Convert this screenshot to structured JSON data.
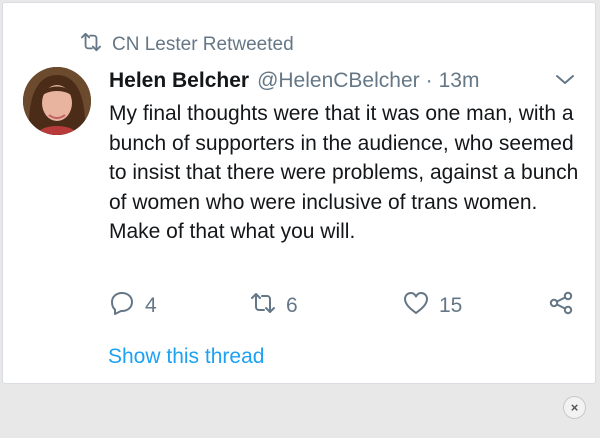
{
  "retweet": {
    "icon": "retweet-icon",
    "text": "CN Lester Retweeted"
  },
  "tweet": {
    "author_name": "Helen Belcher",
    "author_handle": "@HelenCBelcher",
    "separator": "·",
    "time": "13m",
    "text": "My final thoughts were that it was one man, with a bunch of supporters in the audience, who seemed to insist that there were problems, against a bunch of women who were inclusive of trans women. Make of that what you will.",
    "actions": {
      "reply_count": "4",
      "retweet_count": "6",
      "like_count": "15"
    },
    "show_thread": "Show this thread"
  },
  "overlay": {
    "close_glyph": "×"
  },
  "colors": {
    "link": "#1da1f2",
    "muted": "#657786",
    "text": "#14171a"
  }
}
